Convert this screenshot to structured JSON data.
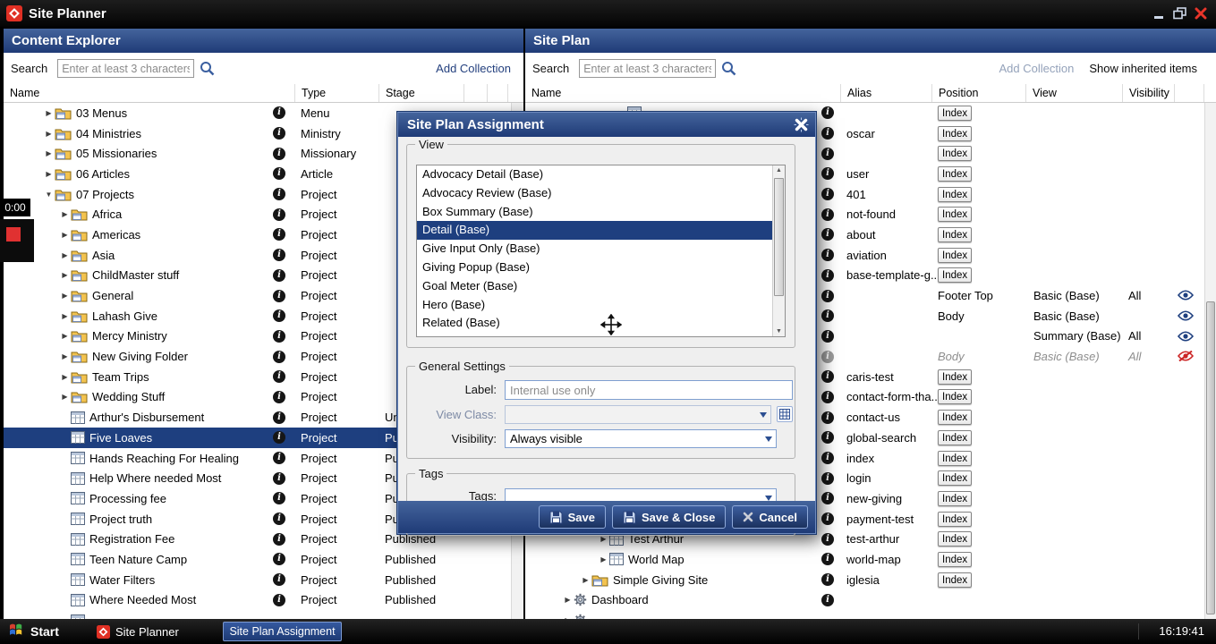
{
  "window": {
    "title": "Site Planner"
  },
  "recorder": {
    "time": "0:00"
  },
  "left_panel": {
    "title": "Content Explorer",
    "search_label": "Search",
    "search_placeholder": "Enter at least 3 characters",
    "add_collection_label": "Add Collection",
    "columns": [
      "Name",
      "Type",
      "Stage"
    ],
    "rows": [
      {
        "indent": 0,
        "arrow": "right",
        "icon": "folder",
        "name": "03 Menus",
        "type": "Menu",
        "stage": ""
      },
      {
        "indent": 0,
        "arrow": "right",
        "icon": "folder",
        "name": "04 Ministries",
        "type": "Ministry",
        "stage": ""
      },
      {
        "indent": 0,
        "arrow": "right",
        "icon": "folder",
        "name": "05 Missionaries",
        "type": "Missionary",
        "stage": ""
      },
      {
        "indent": 0,
        "arrow": "right",
        "icon": "folder",
        "name": "06 Articles",
        "type": "Article",
        "stage": ""
      },
      {
        "indent": 0,
        "arrow": "down",
        "icon": "folder",
        "name": "07 Projects",
        "type": "Project",
        "stage": ""
      },
      {
        "indent": 1,
        "arrow": "right",
        "icon": "folder",
        "name": "Africa",
        "type": "Project",
        "stage": ""
      },
      {
        "indent": 1,
        "arrow": "right",
        "icon": "folder",
        "name": "Americas",
        "type": "Project",
        "stage": ""
      },
      {
        "indent": 1,
        "arrow": "right",
        "icon": "folder",
        "name": "Asia",
        "type": "Project",
        "stage": ""
      },
      {
        "indent": 1,
        "arrow": "right",
        "icon": "folder",
        "name": "ChildMaster stuff",
        "type": "Project",
        "stage": ""
      },
      {
        "indent": 1,
        "arrow": "right",
        "icon": "folder",
        "name": "General",
        "type": "Project",
        "stage": ""
      },
      {
        "indent": 1,
        "arrow": "right",
        "icon": "folder",
        "name": "Lahash Give",
        "type": "Project",
        "stage": ""
      },
      {
        "indent": 1,
        "arrow": "right",
        "icon": "folder",
        "name": "Mercy Ministry",
        "type": "Project",
        "stage": ""
      },
      {
        "indent": 1,
        "arrow": "right",
        "icon": "folder",
        "name": "New Giving Folder",
        "type": "Project",
        "stage": ""
      },
      {
        "indent": 1,
        "arrow": "right",
        "icon": "folder",
        "name": "Team Trips",
        "type": "Project",
        "stage": ""
      },
      {
        "indent": 1,
        "arrow": "right",
        "icon": "folder",
        "name": "Wedding Stuff",
        "type": "Project",
        "stage": ""
      },
      {
        "indent": 1,
        "icon": "grid",
        "name": "Arthur's Disbursement",
        "type": "Project",
        "stage": "Unpublished"
      },
      {
        "indent": 1,
        "icon": "grid",
        "name": "Five Loaves",
        "type": "Project",
        "stage": "Published",
        "selected": true
      },
      {
        "indent": 1,
        "icon": "grid",
        "name": "Hands Reaching For Healing",
        "type": "Project",
        "stage": "Published"
      },
      {
        "indent": 1,
        "icon": "grid",
        "name": "Help Where needed Most",
        "type": "Project",
        "stage": "Published"
      },
      {
        "indent": 1,
        "icon": "grid",
        "name": "Processing fee",
        "type": "Project",
        "stage": "Published"
      },
      {
        "indent": 1,
        "icon": "grid",
        "name": "Project truth",
        "type": "Project",
        "stage": "Published"
      },
      {
        "indent": 1,
        "icon": "grid",
        "name": "Registration Fee",
        "type": "Project",
        "stage": "Published"
      },
      {
        "indent": 1,
        "icon": "grid",
        "name": "Teen Nature Camp",
        "type": "Project",
        "stage": "Published"
      },
      {
        "indent": 1,
        "icon": "grid",
        "name": "Water Filters",
        "type": "Project",
        "stage": "Published"
      },
      {
        "indent": 1,
        "icon": "grid",
        "name": "Where Needed Most",
        "type": "Project",
        "stage": "Published"
      },
      {
        "indent": 1,
        "icon": "grid",
        "name": "",
        "type": "",
        "stage": "",
        "info": false
      }
    ]
  },
  "right_panel": {
    "title": "Site Plan",
    "search_label": "Search",
    "search_placeholder": "Enter at least 3 characters",
    "add_collection_label": "Add Collection",
    "show_inherited_label": "Show inherited items",
    "columns": [
      "Name",
      "Alias",
      "Position",
      "View",
      "Visibility"
    ],
    "rows": [
      {
        "indent": 4,
        "arrow": "right",
        "icon": "grid",
        "name": "",
        "alias": "",
        "position": "Index",
        "position_style": "button"
      },
      {
        "name": "",
        "alias": "oscar",
        "position": "Index",
        "position_style": "button"
      },
      {
        "name": "",
        "alias": "",
        "position": "Index",
        "position_style": "button"
      },
      {
        "name": "",
        "alias": "user",
        "position": "Index",
        "position_style": "button"
      },
      {
        "name": "",
        "alias": "401",
        "position": "Index",
        "position_style": "button"
      },
      {
        "name": "",
        "alias": "not-found",
        "position": "Index",
        "position_style": "button"
      },
      {
        "name": "",
        "alias": "about",
        "position": "Index",
        "position_style": "button"
      },
      {
        "name": "",
        "alias": "aviation",
        "position": "Index",
        "position_style": "button"
      },
      {
        "name": "",
        "alias": "base-template-g...",
        "position": "Index",
        "position_style": "button"
      },
      {
        "name": "",
        "alias": "",
        "position": "Footer Top",
        "position_style": "text",
        "view": "Basic (Base)",
        "visibility": "All",
        "eye": "visible"
      },
      {
        "name": "",
        "alias": "",
        "position": "Body",
        "position_style": "text",
        "view": "Basic (Base)",
        "visibility": "",
        "eye": "visible"
      },
      {
        "name": "",
        "alias": "",
        "position": "",
        "position_style": "text",
        "view": "Summary (Base)",
        "visibility": "All",
        "eye": "visible"
      },
      {
        "name": "",
        "alias": "",
        "position": "Body",
        "position_style": "text",
        "view": "Basic (Base)",
        "visibility": "All",
        "eye": "hidden",
        "muted": true
      },
      {
        "name": "",
        "alias": "caris-test",
        "position": "Index",
        "position_style": "button"
      },
      {
        "name": "",
        "alias": "contact-form-tha...",
        "position": "Index",
        "position_style": "button"
      },
      {
        "name": "",
        "alias": "contact-us",
        "position": "Index",
        "position_style": "button"
      },
      {
        "name": "",
        "alias": "global-search",
        "position": "Index",
        "position_style": "button"
      },
      {
        "name": "",
        "alias": "index",
        "position": "Index",
        "position_style": "button"
      },
      {
        "name": "",
        "alias": "login",
        "position": "Index",
        "position_style": "button"
      },
      {
        "name": "",
        "alias": "new-giving",
        "position": "Index",
        "position_style": "button"
      },
      {
        "name": "",
        "alias": "payment-test",
        "position": "Index",
        "position_style": "button"
      },
      {
        "indent": 3,
        "arrow": "right",
        "icon": "grid",
        "name": "Test Arthur",
        "alias": "test-arthur",
        "position": "Index",
        "position_style": "button"
      },
      {
        "indent": 3,
        "arrow": "right",
        "icon": "grid",
        "name": "World Map",
        "alias": "world-map",
        "position": "Index",
        "position_style": "button"
      },
      {
        "indent": 2,
        "arrow": "right",
        "icon": "folder",
        "name": "Simple Giving Site",
        "alias": "iglesia",
        "position": "Index",
        "position_style": "button"
      },
      {
        "indent": 1,
        "arrow": "right",
        "icon": "gear",
        "name": "Dashboard",
        "alias": ""
      },
      {
        "indent": 1,
        "arrow": "right",
        "icon": "gear",
        "name": "",
        "info": false
      }
    ]
  },
  "dialog": {
    "title": "Site Plan Assignment",
    "groups": {
      "view": "View",
      "general": "General Settings",
      "tags": "Tags"
    },
    "view_options": [
      "Advocacy Detail (Base)",
      "Advocacy Review (Base)",
      "Box Summary (Base)",
      "Detail (Base)",
      "Give Input Only (Base)",
      "Giving Popup (Base)",
      "Goal Meter (Base)",
      "Hero (Base)",
      "Related (Base)"
    ],
    "selected_view": "Detail (Base)",
    "fields": {
      "label_label": "Label:",
      "label_placeholder": "Internal use only",
      "view_class_label": "View Class:",
      "view_class_value": "",
      "visibility_label": "Visibility:",
      "visibility_value": "Always visible",
      "tags_label": "Tags:",
      "tags_value": ""
    },
    "buttons": {
      "save": "Save",
      "save_close": "Save & Close",
      "cancel": "Cancel"
    }
  },
  "taskbar": {
    "start_label": "Start",
    "tasks": [
      {
        "label": "Site Planner",
        "active": false
      },
      {
        "label": "Site Plan Assignment",
        "active": true
      }
    ],
    "clock": "16:19:41"
  }
}
